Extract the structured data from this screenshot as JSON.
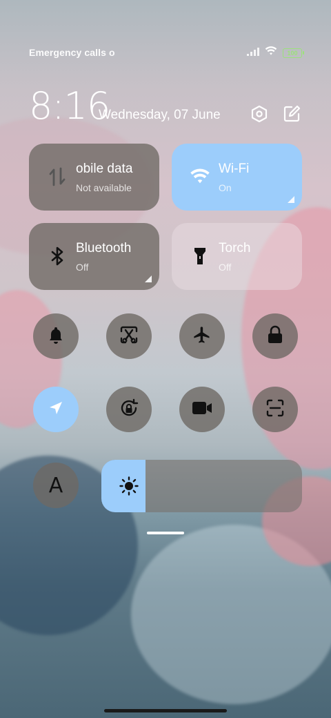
{
  "status": {
    "carrier_text": "Emergency calls o",
    "battery": "100",
    "icons": [
      "signal-icon",
      "wifi-icon",
      "battery-icon"
    ]
  },
  "header": {
    "time": "8:16",
    "date": "Wednesday, 07 June",
    "icons": [
      "settings-icon",
      "edit-icon"
    ]
  },
  "tiles": {
    "mobile_data": {
      "label": "obile data",
      "sub": "Not available",
      "icon": "mobile-data-icon"
    },
    "wifi": {
      "label": "Wi-Fi",
      "sub": "On",
      "icon": "wifi-icon"
    },
    "bluetooth": {
      "label": "Bluetooth",
      "sub": "Off",
      "icon": "bluetooth-icon"
    },
    "torch": {
      "label": "Torch",
      "sub": "Off",
      "icon": "torch-icon"
    }
  },
  "toggles_row1": [
    "bell-icon",
    "screenshot-icon",
    "airplane-icon",
    "lock-icon"
  ],
  "toggles_row2": [
    "location-icon",
    "rotation-lock-icon",
    "video-icon",
    "scan-icon"
  ],
  "font_toggle": {
    "label": "A"
  },
  "brightness": {
    "level": 0.22,
    "icon": "sun-icon"
  },
  "colors": {
    "accent": "#9ccdfb",
    "tile_dark": "#6e6964"
  }
}
